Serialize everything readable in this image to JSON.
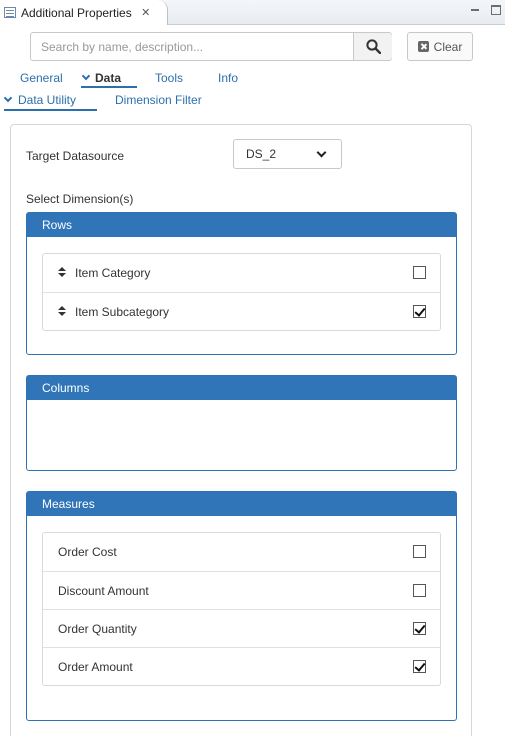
{
  "view": {
    "title": "Additional Properties",
    "close_glyph": "✕"
  },
  "search": {
    "placeholder": "Search by name, description...",
    "clear_label": "Clear"
  },
  "tabs": {
    "general": "General",
    "data": "Data",
    "tools": "Tools",
    "info": "Info"
  },
  "subtabs": {
    "data_utility": "Data Utility",
    "dimension_filter": "Dimension Filter"
  },
  "form": {
    "target_label": "Target Datasource",
    "target_value": "DS_2",
    "select_label": "Select Dimension(s)"
  },
  "rows": {
    "title": "Rows",
    "items": [
      {
        "label": "Item Category",
        "checked": false
      },
      {
        "label": "Item Subcategory",
        "checked": true
      }
    ]
  },
  "columns": {
    "title": "Columns"
  },
  "measures": {
    "title": "Measures",
    "items": [
      {
        "label": "Order Cost",
        "checked": false
      },
      {
        "label": "Discount Amount",
        "checked": false
      },
      {
        "label": "Order Quantity",
        "checked": true
      },
      {
        "label": "Order Amount",
        "checked": true
      }
    ]
  },
  "colors": {
    "accent": "#2f75b8",
    "link": "#2c6fad"
  }
}
